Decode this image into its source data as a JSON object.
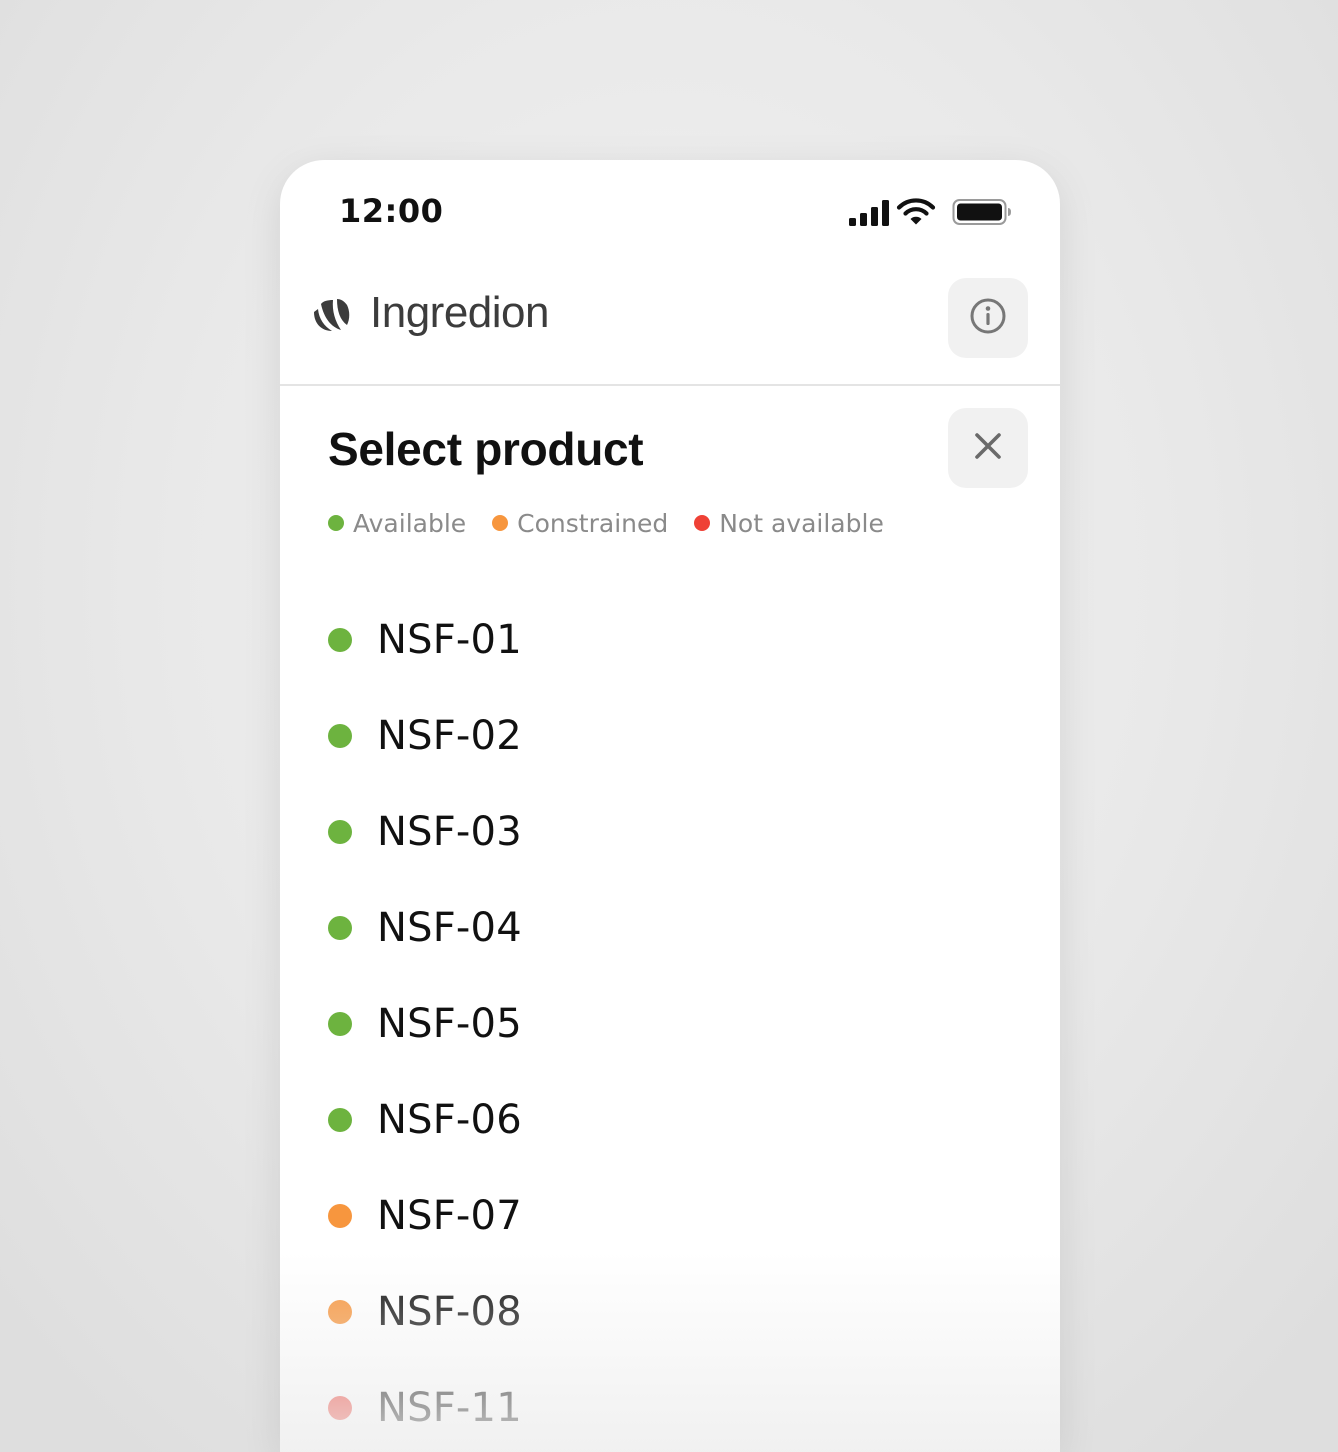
{
  "status_bar": {
    "time": "12:00"
  },
  "app": {
    "brand": "Ingredion",
    "info_icon": "info-icon",
    "close_icon": "close-icon"
  },
  "sheet": {
    "title": "Select product",
    "legend": [
      {
        "label": "Available",
        "color": "#6db33f"
      },
      {
        "label": "Constrained",
        "color": "#f7963e"
      },
      {
        "label": "Not available",
        "color": "#ef4136"
      }
    ]
  },
  "colors": {
    "available": "#6db33f",
    "constrained": "#f7963e",
    "not_available": "#ef4136"
  },
  "products": [
    {
      "name": "NSF-01",
      "status": "available"
    },
    {
      "name": "NSF-02",
      "status": "available"
    },
    {
      "name": "NSF-03",
      "status": "available"
    },
    {
      "name": "NSF-04",
      "status": "available"
    },
    {
      "name": "NSF-05",
      "status": "available"
    },
    {
      "name": "NSF-06",
      "status": "available"
    },
    {
      "name": "NSF-07",
      "status": "constrained"
    },
    {
      "name": "NSF-08",
      "status": "constrained"
    },
    {
      "name": "NSF-11",
      "status": "not_available"
    }
  ]
}
